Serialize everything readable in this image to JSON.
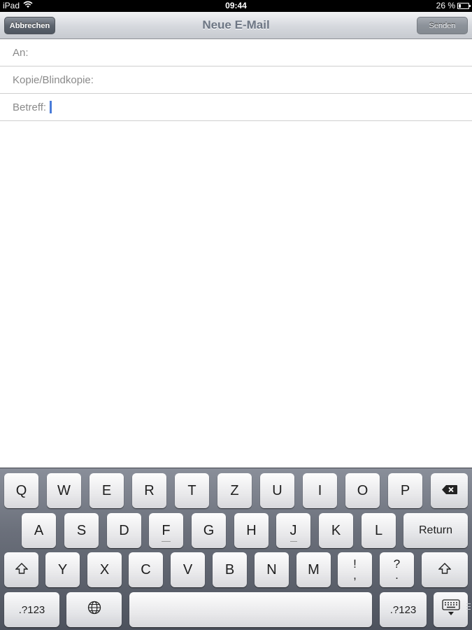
{
  "status_bar": {
    "device": "iPad",
    "time": "09:44",
    "battery_text": "26 %",
    "battery_level": 0.26,
    "wifi_icon": "wifi-icon"
  },
  "nav": {
    "cancel_label": "Abbrechen",
    "title": "Neue E-Mail",
    "send_label": "Senden"
  },
  "compose": {
    "to_label": "An:",
    "ccbcc_label": "Kopie/Blindkopie:",
    "subject_label": "Betreff:"
  },
  "keyboard": {
    "row1": [
      "Q",
      "W",
      "E",
      "R",
      "T",
      "Z",
      "U",
      "I",
      "O",
      "P"
    ],
    "row2": [
      "A",
      "S",
      "D",
      "F",
      "G",
      "H",
      "J",
      "K",
      "L"
    ],
    "return_label": "Return",
    "row3": [
      "Y",
      "X",
      "C",
      "V",
      "B",
      "N",
      "M"
    ],
    "punct1": [
      "!",
      ","
    ],
    "punct2": [
      "?",
      "."
    ],
    "numbers_label": ".?123",
    "numbers_label_right": ".?123",
    "icons": [
      "delete-icon",
      "shift-icon",
      "globe-icon",
      "hide-keyboard-icon"
    ]
  }
}
